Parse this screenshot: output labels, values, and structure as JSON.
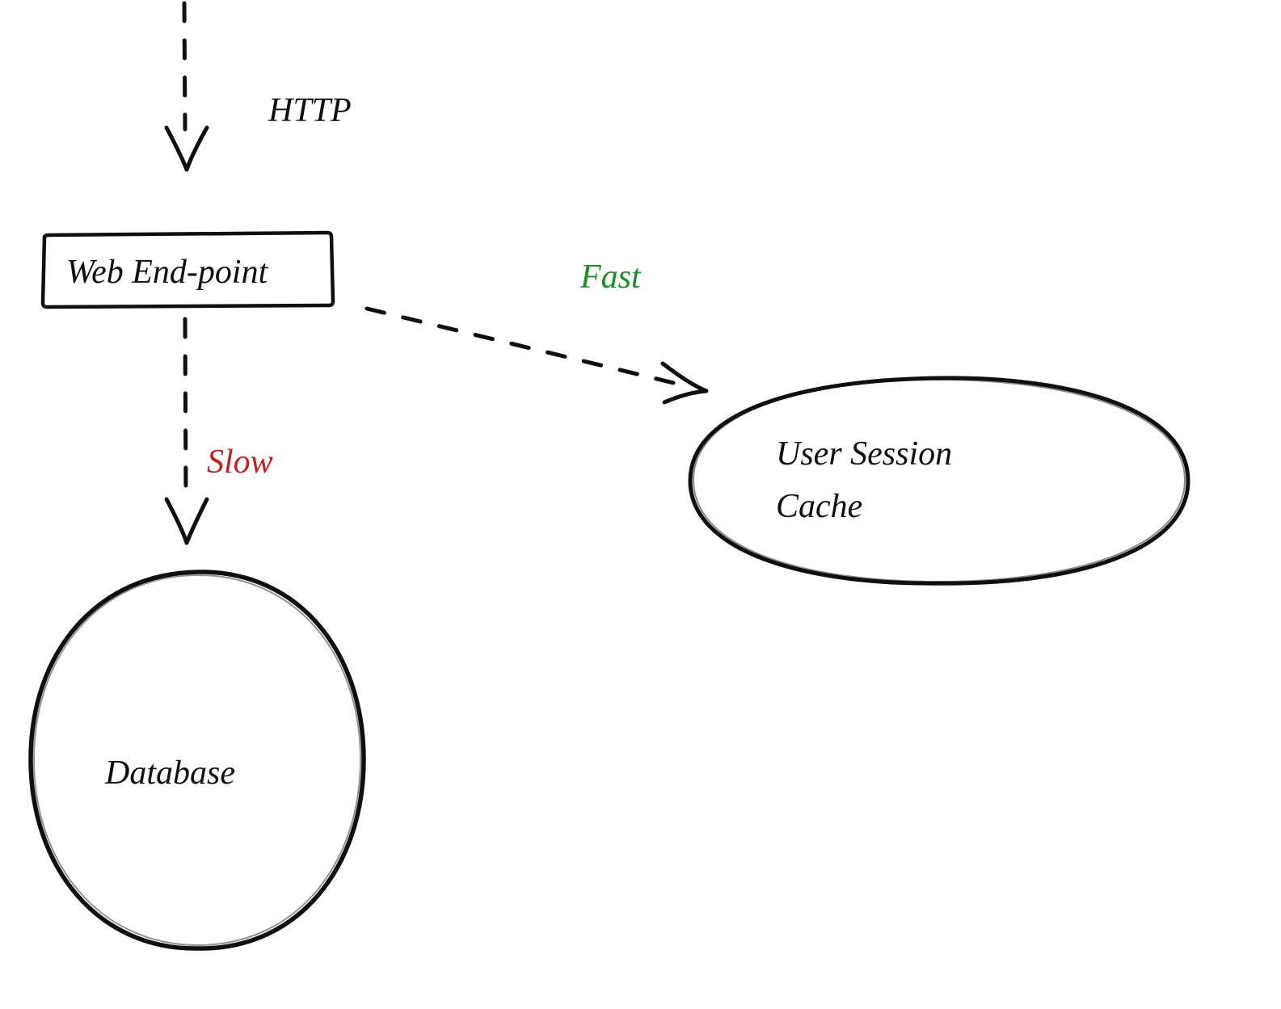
{
  "nodes": {
    "webEndpoint": "Web End-point",
    "database": "Database",
    "userSessionCache1": "User Session",
    "userSessionCache2": "Cache"
  },
  "edges": {
    "http": "HTTP",
    "fast": "Fast",
    "slow": "Slow"
  },
  "colors": {
    "stroke": "#0f0f0f",
    "fast": "#1a8f2a",
    "slow": "#c0221f",
    "background": "#ffffff"
  }
}
